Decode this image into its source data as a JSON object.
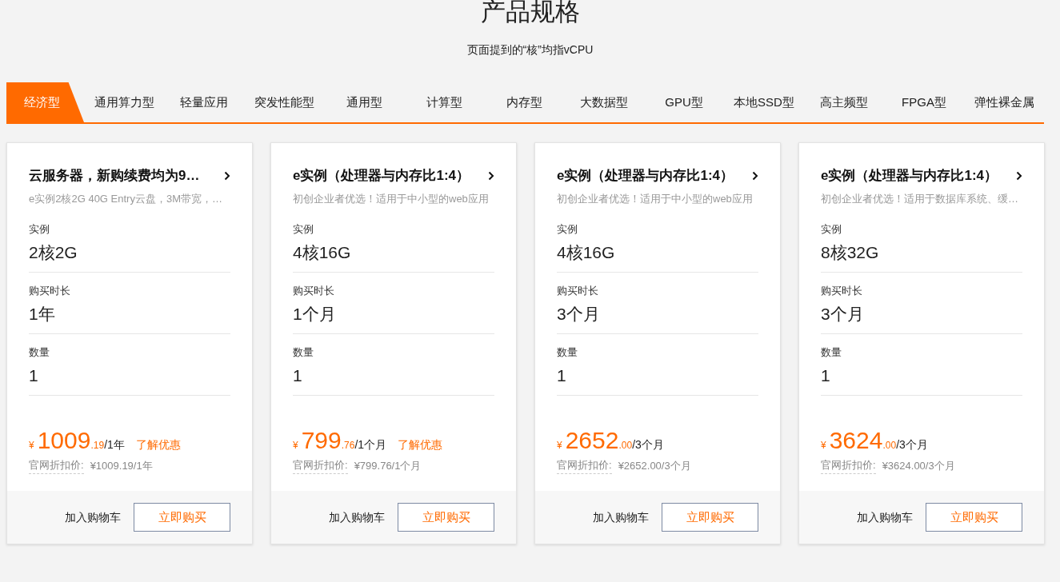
{
  "heading": "产品规格",
  "subtitle": "页面提到的“核”均指vCPU",
  "tabs": [
    {
      "label": "经济型",
      "selected": true
    },
    {
      "label": "通用算力型",
      "selected": false
    },
    {
      "label": "轻量应用",
      "selected": false
    },
    {
      "label": "突发性能型",
      "selected": false
    },
    {
      "label": "通用型",
      "selected": false
    },
    {
      "label": "计算型",
      "selected": false
    },
    {
      "label": "内存型",
      "selected": false
    },
    {
      "label": "大数据型",
      "selected": false
    },
    {
      "label": "GPU型",
      "selected": false
    },
    {
      "label": "本地SSD型",
      "selected": false
    },
    {
      "label": "高主频型",
      "selected": false
    },
    {
      "label": "FPGA型",
      "selected": false
    },
    {
      "label": "弹性裸金属",
      "selected": false
    }
  ],
  "cards": [
    {
      "title": "云服务器，新购续费均为9…",
      "description": "e实例2核2G 40G Entry云盘，3M带宽，…",
      "fields": [
        {
          "label": "实例",
          "value": "2核2G"
        },
        {
          "label": "购买时长",
          "value": "1年"
        },
        {
          "label": "数量",
          "value": "1"
        }
      ],
      "price": {
        "currency": "¥",
        "integer": "1009",
        "decimal": ".19",
        "unit": "/1年",
        "promo": "了解优惠"
      },
      "official_label": "官网折扣价:",
      "official_price": "¥1009.19/1年",
      "cart_button": "加入购物车",
      "buy_button": "立即购买"
    },
    {
      "title": "e实例（处理器与内存比1:4）",
      "description": "初创企业者优选！适用于中小型的web应用",
      "fields": [
        {
          "label": "实例",
          "value": "4核16G"
        },
        {
          "label": "购买时长",
          "value": "1个月"
        },
        {
          "label": "数量",
          "value": "1"
        }
      ],
      "price": {
        "currency": "¥",
        "integer": "799",
        "decimal": ".76",
        "unit": "/1个月",
        "promo": "了解优惠"
      },
      "official_label": "官网折扣价:",
      "official_price": "¥799.76/1个月",
      "cart_button": "加入购物车",
      "buy_button": "立即购买"
    },
    {
      "title": "e实例（处理器与内存比1:4）",
      "description": "初创企业者优选！适用于中小型的web应用",
      "fields": [
        {
          "label": "实例",
          "value": "4核16G"
        },
        {
          "label": "购买时长",
          "value": "3个月"
        },
        {
          "label": "数量",
          "value": "1"
        }
      ],
      "price": {
        "currency": "¥",
        "integer": "2652",
        "decimal": ".00",
        "unit": "/3个月"
      },
      "official_label": "官网折扣价:",
      "official_price": "¥2652.00/3个月",
      "cart_button": "加入购物车",
      "buy_button": "立即购买"
    },
    {
      "title": "e实例（处理器与内存比1:4）",
      "description": "初创企业者优选！适用于数据库系统、缓…",
      "fields": [
        {
          "label": "实例",
          "value": "8核32G"
        },
        {
          "label": "购买时长",
          "value": "3个月"
        },
        {
          "label": "数量",
          "value": "1"
        }
      ],
      "price": {
        "currency": "¥",
        "integer": "3624",
        "decimal": ".00",
        "unit": "/3个月"
      },
      "official_label": "官网折扣价:",
      "official_price": "¥3624.00/3个月",
      "cart_button": "加入购物车",
      "buy_button": "立即购买"
    }
  ]
}
